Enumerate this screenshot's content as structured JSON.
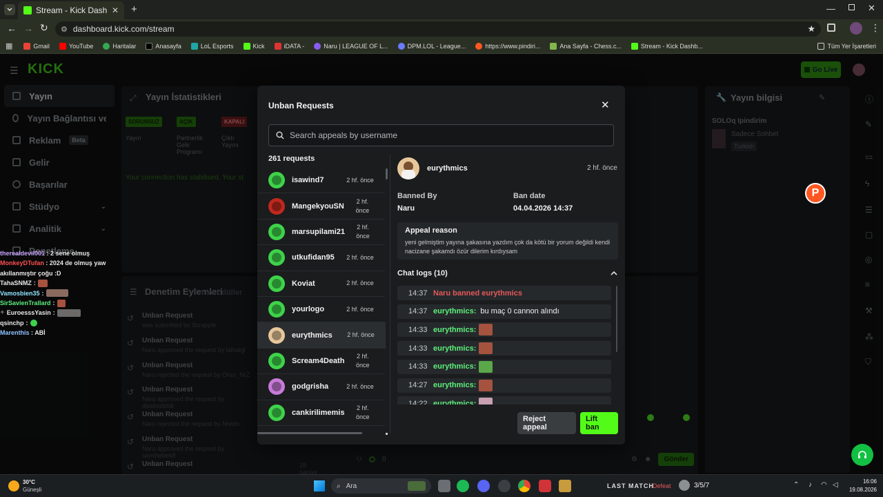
{
  "browser": {
    "tab_title": "Stream - Kick Dashboard",
    "url": "dashboard.kick.com/stream",
    "bookmarks": [
      "Gmail",
      "YouTube",
      "Haritalar",
      "Anasayfa",
      "LoL Esports",
      "Kick",
      "iDATA -",
      "Naru | LEAGUE OF L...",
      "DPM.LOL - League...",
      "https://www.pindiri...",
      "Ana Sayfa - Chess.c...",
      "Stream - Kick Dashb..."
    ],
    "all_bookmarks": "Tüm Yer İşaretleri"
  },
  "kick": {
    "logo": "KICK",
    "go_live": "Go Live",
    "nav": [
      {
        "label": "Yayın"
      },
      {
        "label": "Yayın Bağlantısı ve Anahtar"
      },
      {
        "label": "Reklam",
        "badge": "Beta"
      },
      {
        "label": "Gelir"
      },
      {
        "label": "Başarılar"
      },
      {
        "label": "Stüdyo"
      },
      {
        "label": "Analitik"
      },
      {
        "label": "Denetleme"
      }
    ],
    "stats": {
      "title": "Yayın İstatistikleri",
      "badges": [
        "SORUNSUZ",
        "AÇIK",
        "KAPALI"
      ],
      "labels": [
        "Yayın",
        "Partnerlik Gelir Programı",
        "Çıktı Yayını"
      ],
      "connection": "Your connection has stabilised. Your st"
    },
    "mod_actions": {
      "title": "Denetim Eylemleri",
      "items": [
        {
          "title": "Unban Request",
          "sub": "was submitted by Scrapple"
        },
        {
          "title": "Unban Request",
          "sub": "Naru approved the request by lalhalgl"
        },
        {
          "title": "Unban Request",
          "sub": "Naru rejected the request by Onur_NrZ"
        },
        {
          "title": "Unban Request",
          "sub": "Naru approved the request by dissinizbildr"
        },
        {
          "title": "Unban Request",
          "sub": "Naru rejected the request by Nivoln"
        },
        {
          "title": "Unban Request",
          "sub": "Naru approved the request by semihebek8"
        },
        {
          "title": "Unban Request",
          "sub": "18 saniye önce"
        }
      ],
      "odul_text": "r ve ödüller"
    },
    "info": {
      "title": "Yayın bilgisi",
      "stream_title": "SOLOq Ipindirim",
      "category": "Sadece Sohbet",
      "language": "Turkish"
    },
    "chat_input": {
      "send": "Gönder",
      "count": "0"
    }
  },
  "chat_overlay": [
    {
      "user": "therealdevil001",
      "msg": "2 sene olmuş",
      "color": "#c8a6ff"
    },
    {
      "user": "MonkeyDTufan",
      "msg": "2024 de olmuş yaw akıllanmıştır çoğu :D",
      "color": "#ff4f4f"
    },
    {
      "user": "TahaSNMZ",
      "msg": "",
      "color": "#ffffff"
    },
    {
      "user": "Vamosbien35",
      "msg": "",
      "color": "#8fe3ff"
    },
    {
      "user": "SirSavienTrallard",
      "msg": "",
      "color": "#5cf07a"
    },
    {
      "user": "EuroesssYasin",
      "msg": "",
      "color": "#ffffff"
    },
    {
      "user": "qsinchp",
      "msg": "",
      "color": "#ffffff"
    },
    {
      "user": "Marenthis",
      "msg": "ABİ",
      "color": "#8fc3ff"
    }
  ],
  "modal": {
    "title": "Unban Requests",
    "search_placeholder": "Search appeals by username",
    "count": "261 requests",
    "requests": [
      {
        "name": "isawind7",
        "time": "2 hf. önce",
        "color": "#3ed24a"
      },
      {
        "name": "MangekyouSN",
        "time": "2 hf. önce",
        "color": "#c0281e"
      },
      {
        "name": "marsupilami21",
        "time": "2 hf. önce",
        "color": "#3ed24a"
      },
      {
        "name": "utkufidan95",
        "time": "2 hf. önce",
        "color": "#3ed24a"
      },
      {
        "name": "Koviat",
        "time": "2 hf. önce",
        "color": "#3ed24a"
      },
      {
        "name": "yourlogo",
        "time": "2 hf. önce",
        "color": "#3ed24a"
      },
      {
        "name": "eurythmics",
        "time": "2 hf. önce",
        "color": "#e7c79a"
      },
      {
        "name": "Scream4Death",
        "time": "2 hf. önce",
        "color": "#3ed24a"
      },
      {
        "name": "godgrisha",
        "time": "2 hf. önce",
        "color": "#c77ad8"
      },
      {
        "name": "cankirilimemis",
        "time": "2 hf. önce",
        "color": "#3ed24a"
      }
    ],
    "detail": {
      "user": "eurythmics",
      "time": "2 hf. önce",
      "banned_by_label": "Banned By",
      "banned_by": "Naru",
      "ban_date_label": "Ban date",
      "ban_date": "04.04.2026 14:37",
      "appeal_label": "Appeal reason",
      "appeal_text": "yeni gelmiştim yayına şakasına yazdım çok da kötü bir yorum değildi kendi nacizane şakamdı özür dilerim kırdıysam",
      "chat_logs_label": "Chat logs (10)",
      "logs": [
        {
          "time": "14:37",
          "text": "Naru banned eurythmics",
          "system": true
        },
        {
          "time": "14:37",
          "user": "eurythmics:",
          "text": "bu maç 0 cannon alındı"
        },
        {
          "time": "14:33",
          "user": "eurythmics:",
          "emote": "face"
        },
        {
          "time": "14:33",
          "user": "eurythmics:",
          "emote": "face"
        },
        {
          "time": "14:33",
          "user": "eurythmics:",
          "emote": "frog"
        },
        {
          "time": "14:27",
          "user": "eurythmics:",
          "emote": "face"
        },
        {
          "time": "14:22",
          "user": "eurythmics:",
          "emote": "cat"
        }
      ],
      "reject": "Reject appeal",
      "lift": "Lift ban"
    }
  },
  "taskbar": {
    "temp": "30°C",
    "weather": "Güneşli",
    "search": "Ara",
    "last_match": "LAST MATCH",
    "result": "Defeat",
    "kda": "3/5/7",
    "time": "16:06",
    "date": "19.08.2026"
  },
  "colors": {
    "kick_green": "#53fc18",
    "danger": "#e4585a",
    "accent": "#5cf07a"
  }
}
